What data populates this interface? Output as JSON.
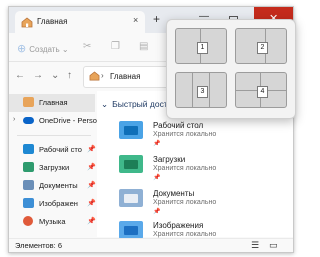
{
  "window": {
    "tab_title": "Главная",
    "tab_close": "×",
    "new_tab": "+",
    "minimize": "—",
    "close": "✕"
  },
  "toolbar": {
    "create_label": "Создать",
    "create_caret": "⌄",
    "cut_icon": "✂",
    "copy_icon": "❐",
    "paste_icon": "▤"
  },
  "navigation": {
    "back": "←",
    "forward": "→",
    "recent": "⌄",
    "up": "↑",
    "address": "Главная",
    "address_chevron": "›"
  },
  "sidebar": {
    "items": [
      {
        "label": "Главная",
        "icon": "home-icon",
        "color": "#e8a45a",
        "selected": true
      },
      {
        "label": "OneDrive - Perso",
        "icon": "onedrive-icon",
        "color": "#0a64c8",
        "expand": "›"
      },
      {
        "label": "Рабочий сто",
        "icon": "desktop-folder-icon",
        "color": "#1e88d2",
        "pin": "📌"
      },
      {
        "label": "Загрузки",
        "icon": "downloads-folder-icon",
        "color": "#2e9b6e",
        "pin": "📌"
      },
      {
        "label": "Документы",
        "icon": "documents-folder-icon",
        "color": "#6b8fb8",
        "pin": "📌"
      },
      {
        "label": "Изображен",
        "icon": "pictures-folder-icon",
        "color": "#3d8fd6",
        "pin": "📌"
      },
      {
        "label": "Музыка",
        "icon": "music-folder-icon",
        "color": "#e05a3a",
        "pin": "📌"
      }
    ]
  },
  "quick_access": {
    "header": "Быстрый доступ",
    "chevron": "⌄",
    "items": [
      {
        "name": "Рабочий стол",
        "status": "Хранится локально",
        "pin": "📌",
        "icon": "desktop-folder-icon",
        "color": "#1e88d2"
      },
      {
        "name": "Загрузки",
        "status": "Хранится локально",
        "pin": "📌",
        "icon": "downloads-folder-icon",
        "color": "#2e9b6e"
      },
      {
        "name": "Документы",
        "status": "Хранится локально",
        "pin": "📌",
        "icon": "documents-folder-icon",
        "color": "#6b8fb8"
      },
      {
        "name": "Изображения",
        "status": "Хранится локально",
        "pin": "📌",
        "icon": "pictures-folder-icon",
        "color": "#3d8fd6"
      }
    ]
  },
  "status": {
    "items_count": "Элементов: 6",
    "details_view": "☰",
    "tiles_view": "▭"
  },
  "snap_layouts": {
    "zones": [
      "1",
      "2",
      "3",
      "4"
    ]
  }
}
